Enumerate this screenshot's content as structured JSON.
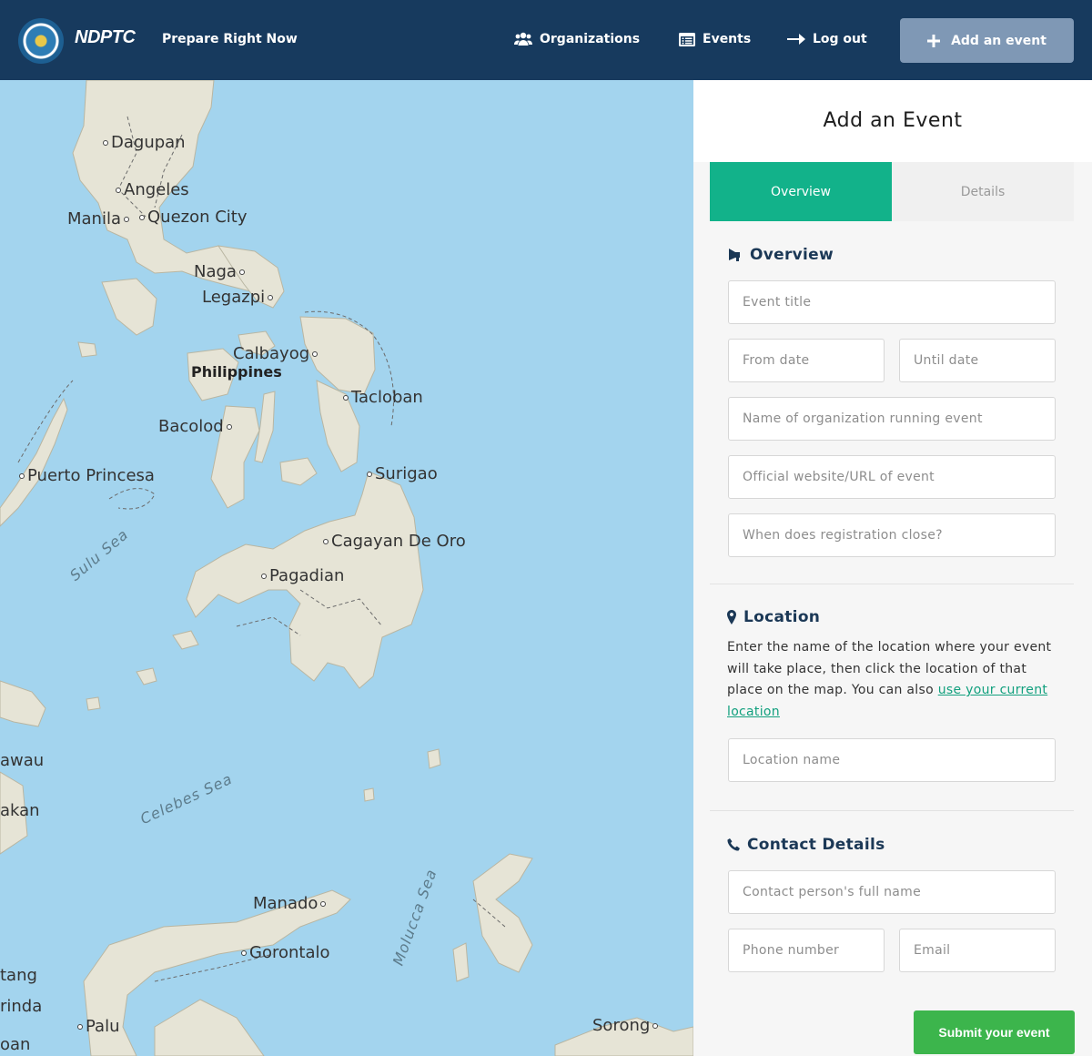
{
  "header": {
    "logo_text": "NDPTC",
    "tagline": "Prepare Right Now",
    "nav": {
      "organizations": "Organizations",
      "events": "Events",
      "logout": "Log out",
      "add_event": "Add an event"
    }
  },
  "map": {
    "places": {
      "dagupan": "Dagupan",
      "angeles": "Angeles",
      "manila": "Manila",
      "quezon": "Quezon City",
      "naga": "Naga",
      "legazpi": "Legazpi",
      "calbayog": "Calbayog",
      "philippines": "Philippines",
      "tacloban": "Tacloban",
      "bacolod": "Bacolod",
      "puerto": "Puerto Princesa",
      "surigao": "Surigao",
      "cagayan": "Cagayan De Oro",
      "pagadian": "Pagadian",
      "awau": "awau",
      "akan": "akan",
      "manado": "Manado",
      "gorontalo": "Gorontalo",
      "tang": "tang",
      "rinda": "rinda",
      "palu": "Palu",
      "oan": "oan",
      "sorong": "Sorong"
    },
    "seas": {
      "sulu": "Sulu Sea",
      "celebes": "Celebes Sea",
      "molucca": "Molucca Sea"
    }
  },
  "panel": {
    "title": "Add an Event",
    "tabs": {
      "overview": "Overview",
      "details": "Details"
    },
    "overview": {
      "title": "Overview",
      "event_title_ph": "Event title",
      "from_date_ph": "From date",
      "until_date_ph": "Until date",
      "org_name_ph": "Name of organization running event",
      "url_ph": "Official website/URL of event",
      "reg_close_ph": "When does registration close?"
    },
    "location": {
      "title": "Location",
      "desc": "Enter the name of the location where your event will take place, then click the location of that place on the map. You can also ",
      "link": "use your current location",
      "name_ph": "Location name"
    },
    "contact": {
      "title": "Contact Details",
      "person_ph": "Contact person's full name",
      "phone_ph": "Phone number",
      "email_ph": "Email"
    },
    "submit": "Submit your event"
  },
  "colors": {
    "header_bg": "#173a5e",
    "accent": "#12b28a",
    "submit_bg": "#3cb54c",
    "map_water": "#a3d4ee",
    "map_land": "#e6e4d6"
  }
}
